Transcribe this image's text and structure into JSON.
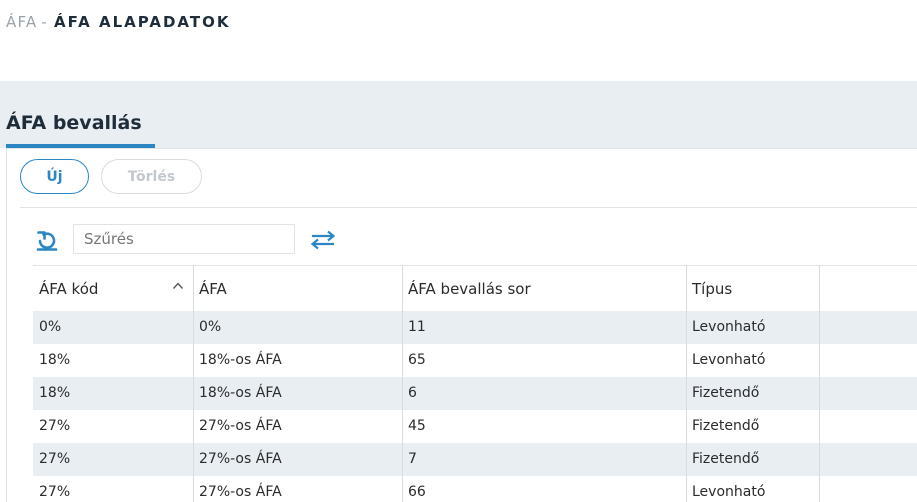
{
  "breadcrumb": {
    "parent": "ÁFA",
    "separator": "-",
    "current": "ÁFA ALAPADATOK"
  },
  "tab": {
    "title": "ÁFA bevallás"
  },
  "toolbar": {
    "new_label": "Új",
    "delete_label": "Törlés"
  },
  "filter": {
    "placeholder": "Szűrés",
    "refresh_icon": "refresh-icon",
    "swap_icon": "swap-arrows-icon"
  },
  "table": {
    "columns": [
      "ÁFA kód",
      "ÁFA",
      "ÁFA bevallás sor",
      "Típus"
    ],
    "sort": {
      "column": "ÁFA kód",
      "direction": "ascending"
    },
    "rows": [
      [
        "0%",
        "0%",
        "11",
        "Levonható"
      ],
      [
        "18%",
        "18%-os ÁFA",
        "65",
        "Levonható"
      ],
      [
        "18%",
        "18%-os ÁFA",
        "6",
        "Fizetendő"
      ],
      [
        "27%",
        "27%-os ÁFA",
        "45",
        "Fizetendő"
      ],
      [
        "27%",
        "27%-os ÁFA",
        "7",
        "Fizetendő"
      ],
      [
        "27%",
        "27%-os ÁFA",
        "66",
        "Levonható"
      ]
    ]
  },
  "colors": {
    "accent": "#2d86c4",
    "row_alt": "#e9eef3",
    "header_band": "#e9eef3"
  }
}
